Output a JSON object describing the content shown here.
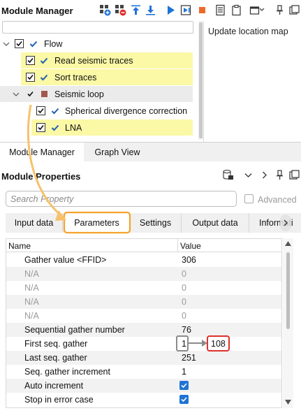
{
  "module_manager": {
    "title": "Module Manager"
  },
  "tree": {
    "items": [
      {
        "label": "Flow"
      },
      {
        "label": "Read seismic traces"
      },
      {
        "label": "Sort traces"
      },
      {
        "label": "Seismic loop"
      },
      {
        "label": "Spherical divergence correction"
      },
      {
        "label": "LNA"
      }
    ]
  },
  "info_panel": {
    "text": "Update location map"
  },
  "bottom_tabs": [
    "Module Manager",
    "Graph View"
  ],
  "module_properties": {
    "title": "Module Properties",
    "search_placeholder": "Search Property",
    "advanced_label": "Advanced",
    "tabs": [
      "Input data",
      "Parameters",
      "Settings",
      "Output data",
      "Informati"
    ],
    "grid": {
      "headers": {
        "name": "Name",
        "value": "Value"
      },
      "rows": [
        {
          "name": "Gather value <FFID>",
          "value": "306"
        },
        {
          "name": "N/A",
          "value": "0"
        },
        {
          "name": "N/A",
          "value": "0"
        },
        {
          "name": "N/A",
          "value": "0"
        },
        {
          "name": "N/A",
          "value": "0"
        },
        {
          "name": "Sequential gather number",
          "value": "76"
        },
        {
          "name": "First seq. gather",
          "value": "1",
          "new_value": "108"
        },
        {
          "name": "Last seq. gather",
          "value": "251"
        },
        {
          "name": "Seq. gather increment",
          "value": "1"
        },
        {
          "name": "Auto increment",
          "value": ""
        },
        {
          "name": "Stop in error case",
          "value": ""
        }
      ]
    }
  },
  "colors": {
    "highlight_yellow": "#fbf8a6",
    "tab_highlight_orange": "#f4a32c",
    "new_value_red": "#e0302c",
    "checkbox_blue": "#1f73d6",
    "check_mark_blue": "#1d5fb0"
  }
}
